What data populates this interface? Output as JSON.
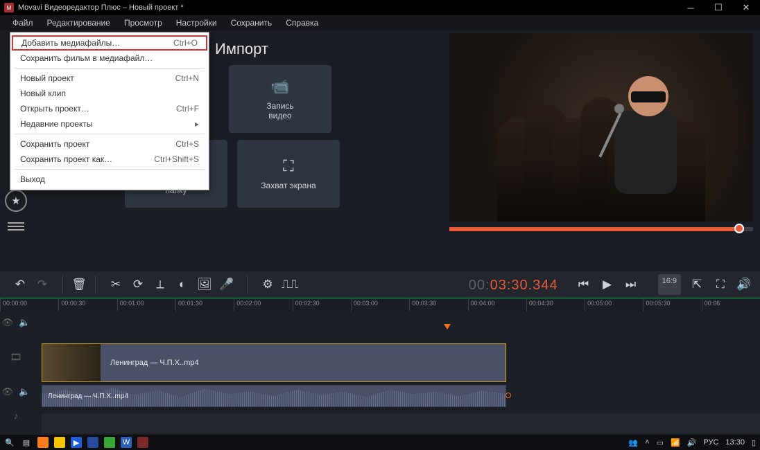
{
  "window": {
    "title": "Movavi Видеоредактор Плюс – Новый проект *"
  },
  "menubar": {
    "file": "Файл",
    "edit": "Редактирование",
    "view": "Просмотр",
    "settings": "Настройки",
    "save": "Сохранить",
    "help": "Справка"
  },
  "file_menu": {
    "add_media": "Добавить медиафайлы…",
    "add_media_sc": "Ctrl+O",
    "save_movie": "Сохранить фильм в медиафайл…",
    "new_project": "Новый проект",
    "new_project_sc": "Ctrl+N",
    "new_clip": "Новый клип",
    "open_project": "Открыть проект…",
    "open_project_sc": "Ctrl+F",
    "recent": "Недавние проекты",
    "recent_arrow": "▸",
    "save_project": "Сохранить проект",
    "save_project_sc": "Ctrl+S",
    "save_project_as": "Сохранить проект как…",
    "save_project_as_sc": "Ctrl+Shift+S",
    "exit": "Выход"
  },
  "import": {
    "heading": "Импорт",
    "record_video": "Запись\nвидео",
    "add_folder": "Добавить\nпапку",
    "screen_capture": "Захват экрана"
  },
  "playback": {
    "timecode_gray": "00:",
    "timecode_orange": "03:30.344",
    "aspect": "16:9"
  },
  "ruler": [
    "00:00:00",
    "00:00:30",
    "00:01:00",
    "00:01:30",
    "00:02:00",
    "00:02:30",
    "00:03:00",
    "00:03:30",
    "00:04:00",
    "00:04:30",
    "00:05:00",
    "00:05:30",
    "00:06"
  ],
  "clips": {
    "video_name": "Ленинград — Ч.П.Х..mp4",
    "audio_name": "Ленинград — Ч.П.Х..mp4"
  },
  "taskbar": {
    "lang": "РУС",
    "clock": "13:30"
  }
}
